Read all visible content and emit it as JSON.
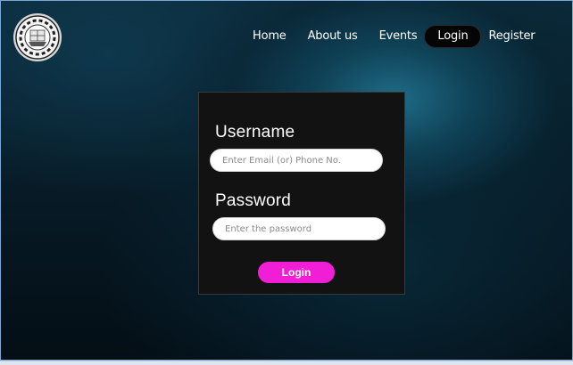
{
  "nav": {
    "items": [
      {
        "label": "Home"
      },
      {
        "label": "About us"
      },
      {
        "label": "Events"
      },
      {
        "label": "Login",
        "active": true
      },
      {
        "label": "Register"
      }
    ]
  },
  "login": {
    "username_label": "Username",
    "username_placeholder": "Enter Email (or) Phone No.",
    "password_label": "Password",
    "password_placeholder": "Enter the password",
    "button_label": "Login"
  },
  "colors": {
    "button": "#f01fd6",
    "card": "#121212",
    "background": "#0b2a3a"
  },
  "icons": {
    "logo": "college-emblem-icon"
  }
}
